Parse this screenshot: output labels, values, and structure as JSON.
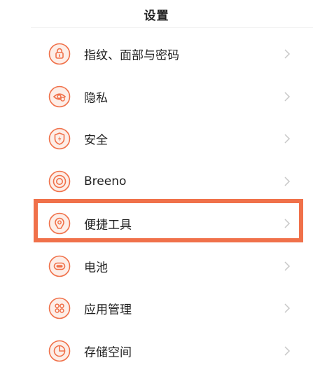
{
  "header": {
    "title": "设置"
  },
  "colors": {
    "icon_accent": "#f0714a",
    "icon_fill": "#fdeee8",
    "highlight_border": "#f0714a",
    "chevron": "#c8c8c8"
  },
  "settings": {
    "items": [
      {
        "label": "指纹、面部与密码",
        "icon": "fingerprint-lock-icon"
      },
      {
        "label": "隐私",
        "icon": "privacy-eye-icon"
      },
      {
        "label": "安全",
        "icon": "security-shield-icon"
      },
      {
        "label": "Breeno",
        "icon": "breeno-icon"
      },
      {
        "label": "便捷工具",
        "icon": "convenience-tools-icon"
      },
      {
        "label": "电池",
        "icon": "battery-icon"
      },
      {
        "label": "应用管理",
        "icon": "app-management-icon"
      },
      {
        "label": "存储空间",
        "icon": "storage-icon"
      }
    ]
  }
}
